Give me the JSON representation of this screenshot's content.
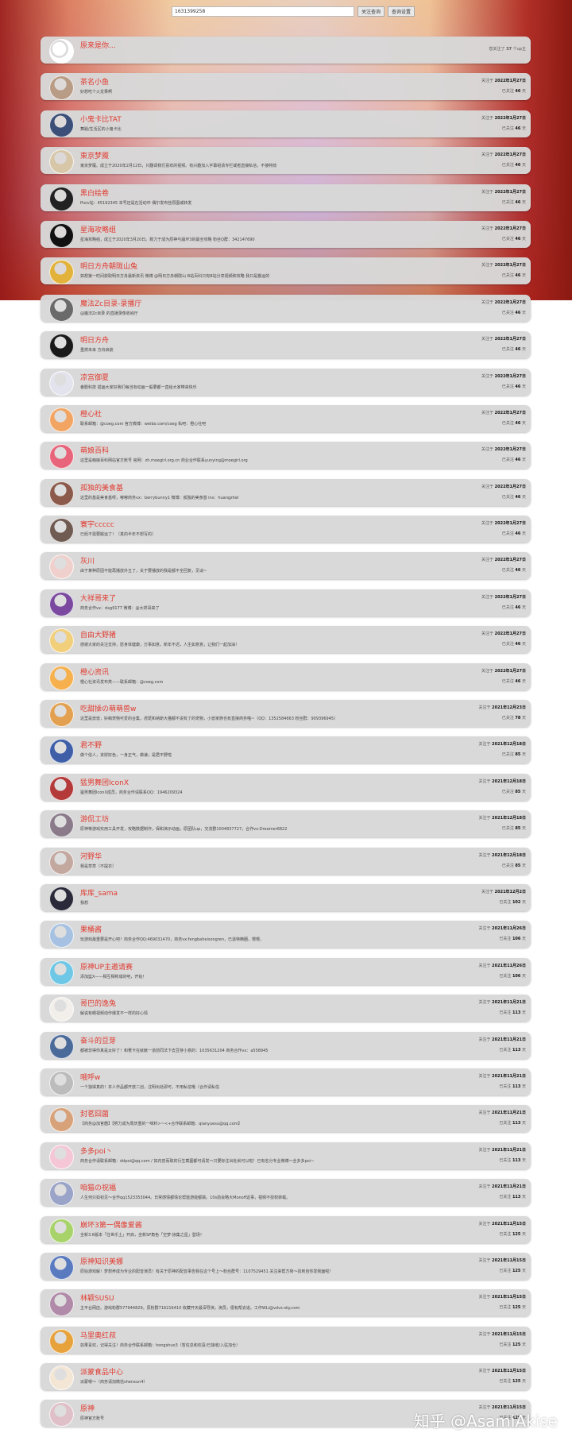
{
  "search": {
    "value": "1631399258",
    "btn1": "关注查询",
    "btn2": "查询设置"
  },
  "self": {
    "name": "原来是你...",
    "following_prefix": "您关注了",
    "following_count": "37",
    "following_suffix": "个up主",
    "avatar_color": "#ffffff"
  },
  "labels": {
    "followed_at": "关注于",
    "followed_for": "已关注",
    "days_unit": "天"
  },
  "entries": [
    {
      "name": "茶名小鱼",
      "desc": "好想吃个火龙果啊",
      "date": "2022年1月27日",
      "days": "46",
      "color": "#b89c86"
    },
    {
      "name": "小鬼卡比TAT",
      "desc": "舞蹈/生活区的小鬼卡比",
      "date": "2022年1月27日",
      "days": "46",
      "color": "#3b4f78"
    },
    {
      "name": "東京梦魇",
      "desc": "東京梦魇。成立于2020年2月12日，只翻译我们喜欢的视频。有兴趣加入字幕组请专栏或者直接私信，不接特效",
      "date": "2022年1月27日",
      "days": "46",
      "color": "#d7c7a8"
    },
    {
      "name": "黑白绘卷",
      "desc": "Pixiv站：45192345 本号还是在活动中 偶尔发布些原图或转发",
      "date": "2022年1月27日",
      "days": "46",
      "color": "#222222"
    },
    {
      "name": "星海攻略组",
      "desc": "星海攻略组，成立于2020年3月20日。致力于成为原神与崩坏3的最全攻略 粉丝Q群：342147690",
      "date": "2022年1月27日",
      "days": "46",
      "color": "#111111"
    },
    {
      "name": "明日方舟朝陇山兔",
      "desc": "如想第一时间获取明日方舟最新资讯 微博 @明日方舟朝陇山 B站百科只有B站分享视频和攻略 我只是搬运的",
      "date": "2022年1月27日",
      "days": "46",
      "color": "#e2b23a"
    },
    {
      "name": "魔法Zc目录-录播厅",
      "desc": "@魔法Zc目录 的直播录像收纳厅",
      "date": "2022年1月27日",
      "days": "46",
      "color": "#6a6a6a"
    },
    {
      "name": "明日方舟",
      "desc": "重燃未来 方舟启航",
      "date": "2022年1月27日",
      "days": "46",
      "color": "#1a1a1a"
    },
    {
      "name": "凉宫御夏",
      "desc": "番剧科技 插画大家好我们每当有动画一般要都一直给大家带来快乐",
      "date": "2022年1月27日",
      "days": "46",
      "color": "#e3e3ee"
    },
    {
      "name": "橙心社",
      "desc": "联系邮箱：@coeg.com 官方微博：weibo.com/coeg 私吧：橙心社吧",
      "date": "2022年1月27日",
      "days": "46",
      "color": "#f2a563"
    },
    {
      "name": "萌娘百科",
      "desc": "这里是萌娘百科网站官方账号 官网：zh.moegirl.org.cn 商业合作联系yunying@moegirl.org",
      "date": "2022年1月27日",
      "days": "46",
      "color": "#e8647a"
    },
    {
      "name": "孤独的美食基",
      "desc": "这里的基是美食基呀，嘟嘟商务vx：berrybunny1 微博：孤独的美食基 ins：huangzhel",
      "date": "2022年1月27日",
      "days": "46",
      "color": "#8b5a4a"
    },
    {
      "name": "寰宇ccccc",
      "desc": "已经不需要搬运了！（真的半年不想写的）",
      "date": "2022年1月27日",
      "days": "46",
      "color": "#6f5b52"
    },
    {
      "name": "灰川",
      "desc": "由于某种原因不能再播放外五了，关于要播放的我是都不全回复，见谅~",
      "date": "2022年1月27日",
      "days": "46",
      "color": "#f0d0cc"
    },
    {
      "name": "大祥哥来了",
      "desc": "商务合作vx：dxg9177 微博：@大祥哥来了",
      "date": "2022年1月27日",
      "days": "46",
      "color": "#7b4aa0"
    },
    {
      "name": "自由大野猪",
      "desc": "感谢大家的关注支持，愿身体健康，万事如意，新年不迟，人生如意意，让我们一起加油！",
      "date": "2022年1月27日",
      "days": "46",
      "color": "#f1cf7b"
    },
    {
      "name": "橙心资讯",
      "desc": "橙心社资讯发布类——联系邮箱：@coeg.com",
      "date": "2022年1月27日",
      "days": "46",
      "color": "#f6b04e"
    },
    {
      "name": "吃甜操の萌萌兽w",
      "desc": "这里是兽兽，好萌宠物可爱的合集，虎斑和纳斯大猫都不说有了的宠物，小兽家族也有直接商务喵~（QQ：1352584663 粉丝群：909396945）",
      "date": "2021年12月23日",
      "days": "78",
      "color": "#e2a050"
    },
    {
      "name": "君不野",
      "desc": "做个俗人，贪财好色，一身正气，做谦；是君不野啦",
      "date": "2021年12月18日",
      "days": "85",
      "color": "#3e5fa8"
    },
    {
      "name": "猛男舞团IconX",
      "desc": "猛男舞团IconX成员，商务合作请联系QQ：1946209324",
      "date": "2021年12月18日",
      "days": "85",
      "color": "#b43a3a"
    },
    {
      "name": "游侃工坊",
      "desc": "原神等游戏实用工具开发，攻略数据制作，保和演示动画，原团队up，交流群1004837727，合作vx:Dreamer6822",
      "date": "2021年12月18日",
      "days": "85",
      "color": "#8a7a8a"
    },
    {
      "name": "河野华",
      "desc": "我是草草（不提衣）",
      "date": "2021年12月18日",
      "days": "85",
      "color": "#c3a8a0"
    },
    {
      "name": "库库_sama",
      "desc": "我想",
      "date": "2021年12月2日",
      "days": "102",
      "color": "#2a2a3a"
    },
    {
      "name": "果桶酱",
      "desc": "玩游戏最重要是开心吧！商务合作QQ:469031470，商务vx:fengbaheisongren，已退特精圈，慢慢。",
      "date": "2021年11月26日",
      "days": "106",
      "color": "#a7c1e2"
    },
    {
      "name": "原神UP主邀请赛",
      "desc": "添加篮X——相互相称成的吧，开始！",
      "date": "2021年11月26日",
      "days": "106",
      "color": "#6fc7e6"
    },
    {
      "name": "哥巴的逸兔",
      "desc": "解说有眼视频动作爆发不一样的好心情",
      "date": "2021年11月21日",
      "days": "113",
      "color": "#f2eeea"
    },
    {
      "name": "奋斗的豆芽",
      "desc": "都被非得你真是太好了！和著卡在就献一道前同法下去豆芽小意的：1035631204 商务合作vx：a558945",
      "date": "2021年11月21日",
      "days": "113",
      "color": "#4a6a9a"
    },
    {
      "name": "哦呼w",
      "desc": "一个独得真的！本人作品都开放二创，注明出处即可，不用私信哦（合作请私信",
      "date": "2021年11月21日",
      "days": "113",
      "color": "#bcbcbc"
    },
    {
      "name": "封茗囧菌",
      "desc": "【商务@加官菌】【努力成为周庆重的一味料>~<+合作联系邮箱：qianyuesu@qq.com】",
      "date": "2021年11月21日",
      "days": "113",
      "color": "#d7a27a"
    },
    {
      "name": "多多poi丶",
      "desc": "商务合作请联系邮箱：ddpoi@qq.com / 如内容而取的衍生截图都可请发～只要标注出处就可以啦！已有名分专业微博～全多多poi~",
      "date": "2021年11月21日",
      "days": "113",
      "color": "#f5c7d6"
    },
    {
      "name": "咱猫の祝福",
      "desc": "人生何只如初见～合作qq1523353044。日常感情都情论帮能游能都搞。10s前会略大Monoff这事，视频不授权转载。",
      "date": "2021年11月21日",
      "days": "113",
      "color": "#9aa3c8"
    },
    {
      "name": "崩坏3第一偶像爱酱",
      "desc": "全新3.6版本「往世乐土」开启，全新SP角色「空梦·掠集之星」登场！",
      "date": "2021年11月15日",
      "days": "125",
      "color": "#a8d36a"
    },
    {
      "name": "原神知识美娜",
      "desc": "原始游戏解！梦想养成为专业的配音演员！有关于原神的配音事告我在这个号上～粉丝群号：1107529451 关注来帮方荷～找到自你发我面啦！",
      "date": "2021年11月15日",
      "days": "125",
      "color": "#5a7ac0"
    },
    {
      "name": "林颖SUSU",
      "desc": "主平台网店。游戏粉群577944829。原粉群716216410 收藏开天最深导演，演员，很有帮去道。工作WLi@vdvs-sky.com",
      "date": "2021年11月15日",
      "days": "125",
      "color": "#b08aa8"
    },
    {
      "name": "马里奥红叔",
      "desc": "如果喜欢，记得关注！商务合作联系邮箱：hongshuo3（暂信息和欢喜/已接收/入驻加仓）",
      "date": "2021年11月15日",
      "days": "125",
      "color": "#e7a23c"
    },
    {
      "name": "派蒙食品中心",
      "desc": "派蒙嗯～（商务请加微信shenxun4）",
      "date": "2021年11月15日",
      "days": "125",
      "color": "#f4e6d4"
    },
    {
      "name": "原神",
      "desc": "原神官方账号",
      "date": "2021年11月15日",
      "days": "125",
      "color": "#e0c0c8"
    }
  ],
  "watermark": "知乎 @AsamiAkise"
}
